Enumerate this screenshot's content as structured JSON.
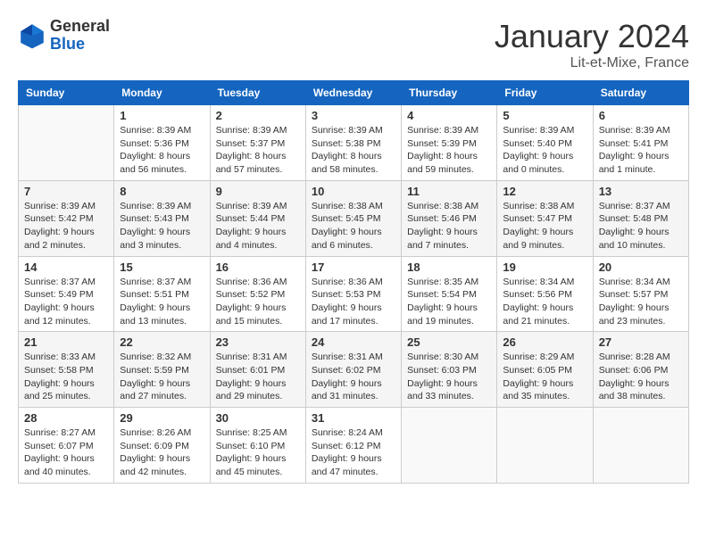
{
  "header": {
    "logo_general": "General",
    "logo_blue": "Blue",
    "month_title": "January 2024",
    "location": "Lit-et-Mixe, France"
  },
  "calendar": {
    "columns": [
      "Sunday",
      "Monday",
      "Tuesday",
      "Wednesday",
      "Thursday",
      "Friday",
      "Saturday"
    ],
    "weeks": [
      [
        {
          "day": "",
          "info": ""
        },
        {
          "day": "1",
          "info": "Sunrise: 8:39 AM\nSunset: 5:36 PM\nDaylight: 8 hours\nand 56 minutes."
        },
        {
          "day": "2",
          "info": "Sunrise: 8:39 AM\nSunset: 5:37 PM\nDaylight: 8 hours\nand 57 minutes."
        },
        {
          "day": "3",
          "info": "Sunrise: 8:39 AM\nSunset: 5:38 PM\nDaylight: 8 hours\nand 58 minutes."
        },
        {
          "day": "4",
          "info": "Sunrise: 8:39 AM\nSunset: 5:39 PM\nDaylight: 8 hours\nand 59 minutes."
        },
        {
          "day": "5",
          "info": "Sunrise: 8:39 AM\nSunset: 5:40 PM\nDaylight: 9 hours\nand 0 minutes."
        },
        {
          "day": "6",
          "info": "Sunrise: 8:39 AM\nSunset: 5:41 PM\nDaylight: 9 hours\nand 1 minute."
        }
      ],
      [
        {
          "day": "7",
          "info": "Sunrise: 8:39 AM\nSunset: 5:42 PM\nDaylight: 9 hours\nand 2 minutes."
        },
        {
          "day": "8",
          "info": "Sunrise: 8:39 AM\nSunset: 5:43 PM\nDaylight: 9 hours\nand 3 minutes."
        },
        {
          "day": "9",
          "info": "Sunrise: 8:39 AM\nSunset: 5:44 PM\nDaylight: 9 hours\nand 4 minutes."
        },
        {
          "day": "10",
          "info": "Sunrise: 8:38 AM\nSunset: 5:45 PM\nDaylight: 9 hours\nand 6 minutes."
        },
        {
          "day": "11",
          "info": "Sunrise: 8:38 AM\nSunset: 5:46 PM\nDaylight: 9 hours\nand 7 minutes."
        },
        {
          "day": "12",
          "info": "Sunrise: 8:38 AM\nSunset: 5:47 PM\nDaylight: 9 hours\nand 9 minutes."
        },
        {
          "day": "13",
          "info": "Sunrise: 8:37 AM\nSunset: 5:48 PM\nDaylight: 9 hours\nand 10 minutes."
        }
      ],
      [
        {
          "day": "14",
          "info": "Sunrise: 8:37 AM\nSunset: 5:49 PM\nDaylight: 9 hours\nand 12 minutes."
        },
        {
          "day": "15",
          "info": "Sunrise: 8:37 AM\nSunset: 5:51 PM\nDaylight: 9 hours\nand 13 minutes."
        },
        {
          "day": "16",
          "info": "Sunrise: 8:36 AM\nSunset: 5:52 PM\nDaylight: 9 hours\nand 15 minutes."
        },
        {
          "day": "17",
          "info": "Sunrise: 8:36 AM\nSunset: 5:53 PM\nDaylight: 9 hours\nand 17 minutes."
        },
        {
          "day": "18",
          "info": "Sunrise: 8:35 AM\nSunset: 5:54 PM\nDaylight: 9 hours\nand 19 minutes."
        },
        {
          "day": "19",
          "info": "Sunrise: 8:34 AM\nSunset: 5:56 PM\nDaylight: 9 hours\nand 21 minutes."
        },
        {
          "day": "20",
          "info": "Sunrise: 8:34 AM\nSunset: 5:57 PM\nDaylight: 9 hours\nand 23 minutes."
        }
      ],
      [
        {
          "day": "21",
          "info": "Sunrise: 8:33 AM\nSunset: 5:58 PM\nDaylight: 9 hours\nand 25 minutes."
        },
        {
          "day": "22",
          "info": "Sunrise: 8:32 AM\nSunset: 5:59 PM\nDaylight: 9 hours\nand 27 minutes."
        },
        {
          "day": "23",
          "info": "Sunrise: 8:31 AM\nSunset: 6:01 PM\nDaylight: 9 hours\nand 29 minutes."
        },
        {
          "day": "24",
          "info": "Sunrise: 8:31 AM\nSunset: 6:02 PM\nDaylight: 9 hours\nand 31 minutes."
        },
        {
          "day": "25",
          "info": "Sunrise: 8:30 AM\nSunset: 6:03 PM\nDaylight: 9 hours\nand 33 minutes."
        },
        {
          "day": "26",
          "info": "Sunrise: 8:29 AM\nSunset: 6:05 PM\nDaylight: 9 hours\nand 35 minutes."
        },
        {
          "day": "27",
          "info": "Sunrise: 8:28 AM\nSunset: 6:06 PM\nDaylight: 9 hours\nand 38 minutes."
        }
      ],
      [
        {
          "day": "28",
          "info": "Sunrise: 8:27 AM\nSunset: 6:07 PM\nDaylight: 9 hours\nand 40 minutes."
        },
        {
          "day": "29",
          "info": "Sunrise: 8:26 AM\nSunset: 6:09 PM\nDaylight: 9 hours\nand 42 minutes."
        },
        {
          "day": "30",
          "info": "Sunrise: 8:25 AM\nSunset: 6:10 PM\nDaylight: 9 hours\nand 45 minutes."
        },
        {
          "day": "31",
          "info": "Sunrise: 8:24 AM\nSunset: 6:12 PM\nDaylight: 9 hours\nand 47 minutes."
        },
        {
          "day": "",
          "info": ""
        },
        {
          "day": "",
          "info": ""
        },
        {
          "day": "",
          "info": ""
        }
      ]
    ]
  }
}
